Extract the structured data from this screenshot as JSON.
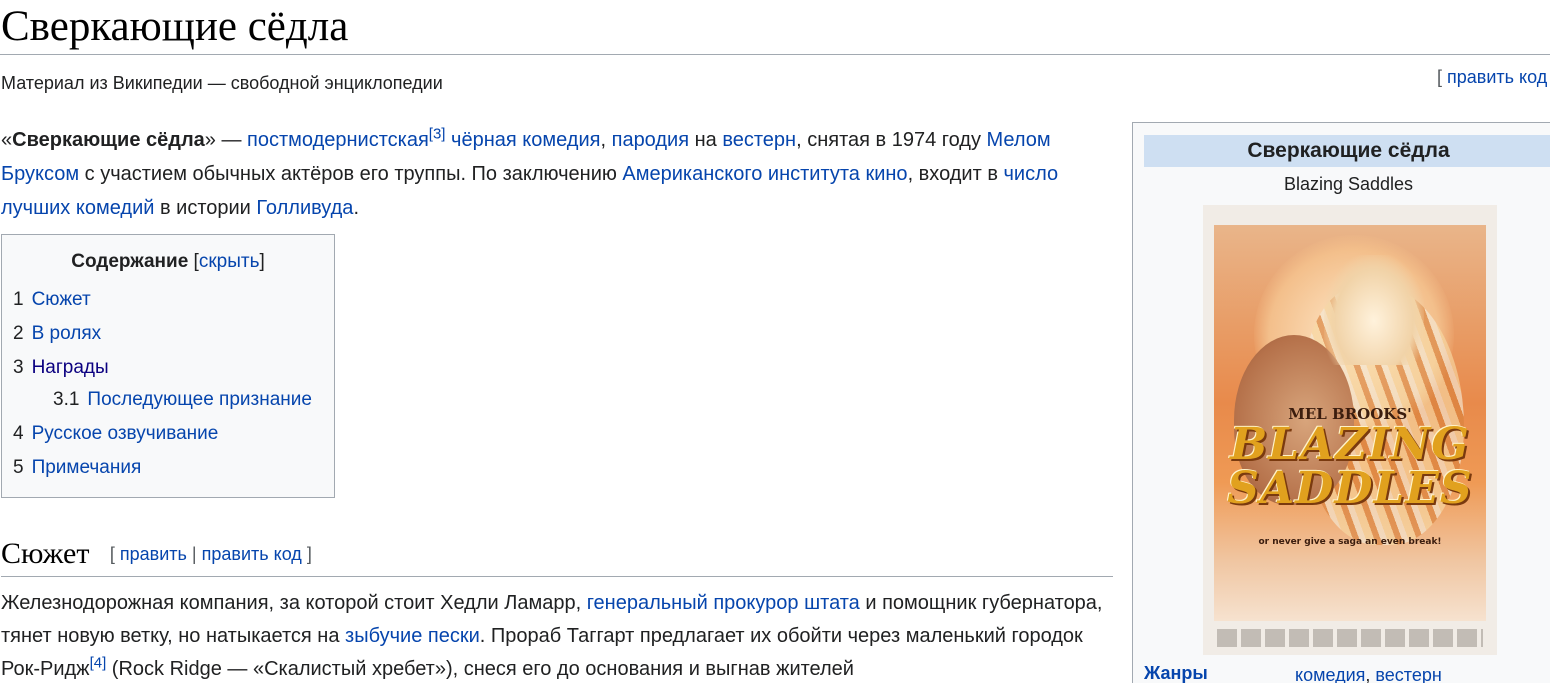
{
  "article": {
    "title": "Сверкающие сёдла",
    "tagline": "Материал из Википедии — свободной энциклопедии",
    "top_edit": {
      "open": "[ ",
      "label": "править код"
    }
  },
  "lead": {
    "q_open": "«",
    "bold": "Сверкающие сёдла",
    "q_close": "» — ",
    "l1": "постмодернистская",
    "ref1": "[3]",
    "t1": " ",
    "l2": "чёрная комедия",
    "t2": ", ",
    "l3": "пародия",
    "t3": " на ",
    "l4": "вестерн",
    "t4": ", снятая в 1974 году ",
    "l5": "Мелом Бруксом",
    "t5": " с участием обычных актёров его труппы. По заключению ",
    "l6": "Американского института кино",
    "t6": ", входит в ",
    "l7": "число лучших комедий",
    "t7": " в истории ",
    "l8": "Голливуда",
    "t8": "."
  },
  "toc": {
    "title": "Содержание",
    "toggle_open": " [",
    "toggle": "скрыть",
    "toggle_close": "]",
    "items": [
      {
        "num": "1",
        "label": "Сюжет"
      },
      {
        "num": "2",
        "label": "В ролях"
      },
      {
        "num": "3",
        "label": "Награды"
      },
      {
        "num": "3.1",
        "label": "Последующее признание"
      },
      {
        "num": "4",
        "label": "Русское озвучивание"
      },
      {
        "num": "5",
        "label": "Примечания"
      }
    ]
  },
  "section": {
    "title": "Сюжет",
    "edit_open": "[ ",
    "edit": "править",
    "sep": " | ",
    "edit_code": "править код",
    "edit_close": " ]"
  },
  "plot": {
    "t1": "Железнодорожная компания, за которой стоит Хедли Ламарр, ",
    "l1": "генеральный прокурор штата",
    "t2": " и помощник губернатора, тянет новую ветку, но натыкается на ",
    "l2": "зыбучие пески",
    "t3": ". Прораб Таггарт предлагает их обойти через маленький городок Рок-Ридж",
    "ref": "[4]",
    "t4": " (Rock Ridge — «Скалистый хребет»), снеся его до основания и выгнав жителей"
  },
  "infobox": {
    "title": "Сверкающие сёдла",
    "original_title": "Blazing Saddles",
    "poster": {
      "mel": "MEL BROOKS'",
      "logo_line1": "BLAZING",
      "logo_line2": "SADDLES",
      "tagline": "or never give a saga an even break!"
    },
    "genre_label": "Жанры",
    "genre_l1": "комедия",
    "genre_sep": ", ",
    "genre_l2": "вестерн"
  }
}
